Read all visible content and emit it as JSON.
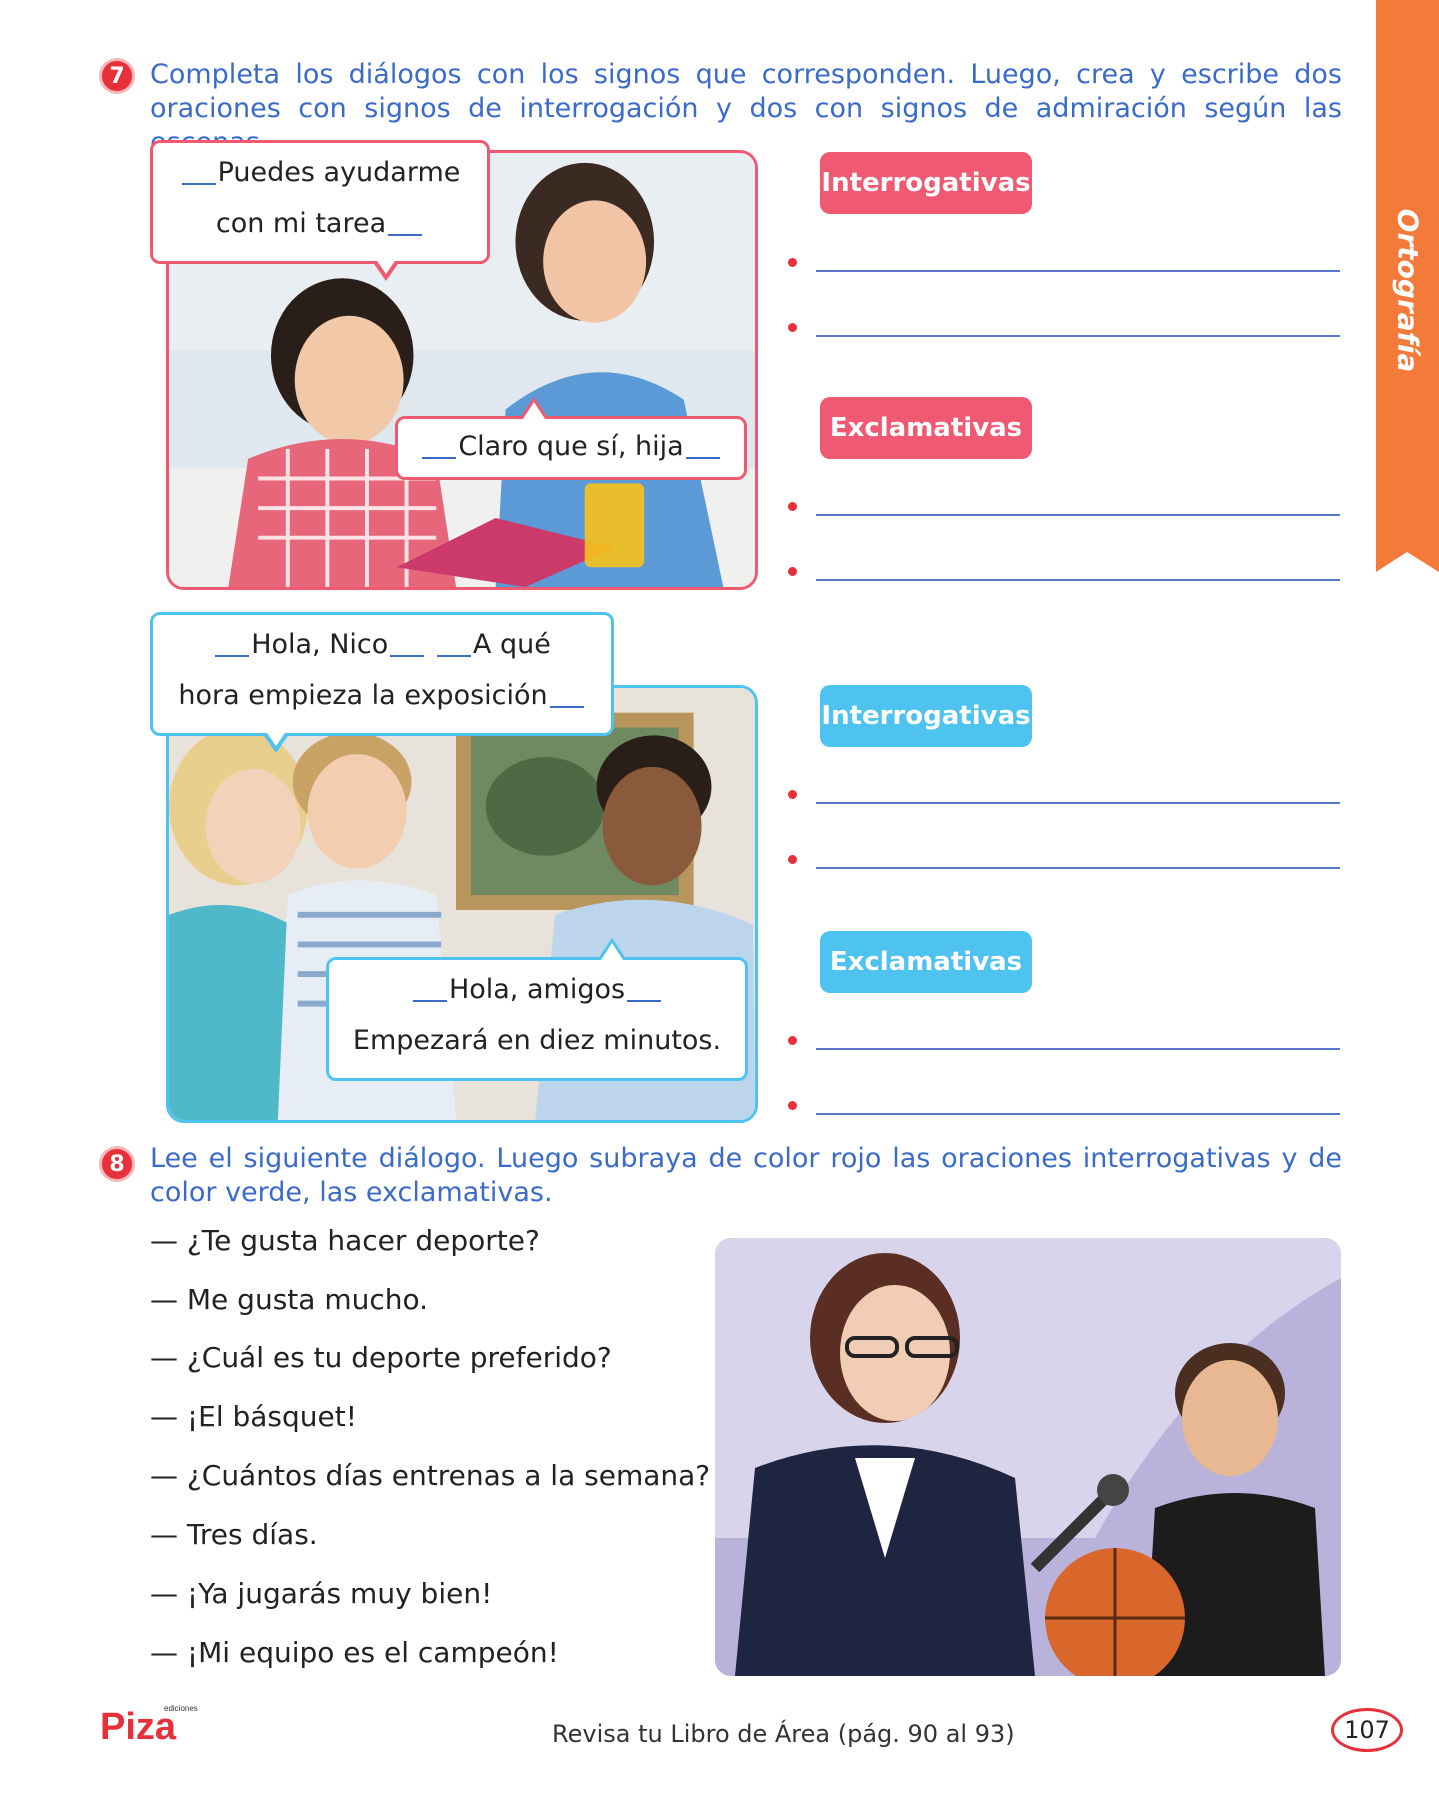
{
  "side_tab": {
    "label": "Ortografía",
    "color": "#f47a3a"
  },
  "exercise7": {
    "number": "7",
    "instruction": "Completa los diálogos con los signos que corresponden. Luego, crea y escribe dos oraciones con signos de interrogación y dos con signos de admiración según las escenas.",
    "scene1": {
      "bubble1": {
        "line1": "Puedes ayudarme",
        "line2": "con mi tarea"
      },
      "bubble2": {
        "line1": "Claro que sí, hija"
      },
      "label_interrogativas": "Interrogativas",
      "label_exclamativas": "Exclamativas"
    },
    "scene2": {
      "bubble1": {
        "line1a": "Hola, Nico",
        "line1b": "A qué",
        "line2": "hora empieza la exposición"
      },
      "bubble2": {
        "line1": "Hola, amigos",
        "line2": "Empezará en diez minutos."
      },
      "label_interrogativas": "Interrogativas",
      "label_exclamativas": "Exclamativas"
    }
  },
  "exercise8": {
    "number": "8",
    "instruction": "Lee el siguiente diálogo. Luego subraya de color rojo las oraciones interrogativas y de color verde, las exclamativas.",
    "dialogue": [
      "— ¿Te gusta hacer deporte?",
      "— Me gusta mucho.",
      "— ¿Cuál es tu deporte preferido?",
      "— ¡El básquet!",
      "— ¿Cuántos días entrenas a la semana?",
      "— Tres días.",
      "— ¡Ya jugarás muy bien!",
      "— ¡Mi equipo es el campeón!"
    ]
  },
  "footer": {
    "brand": "Piza",
    "brand_small": "ediciones",
    "text": "Revisa tu Libro de Área (pág. 90 al 93)",
    "page_number": "107"
  },
  "colors": {
    "instruction_blue": "#3a6bc9",
    "accent_red": "#e8303a",
    "label_pink": "#ef5a72",
    "label_cyan": "#4fc3ef"
  }
}
